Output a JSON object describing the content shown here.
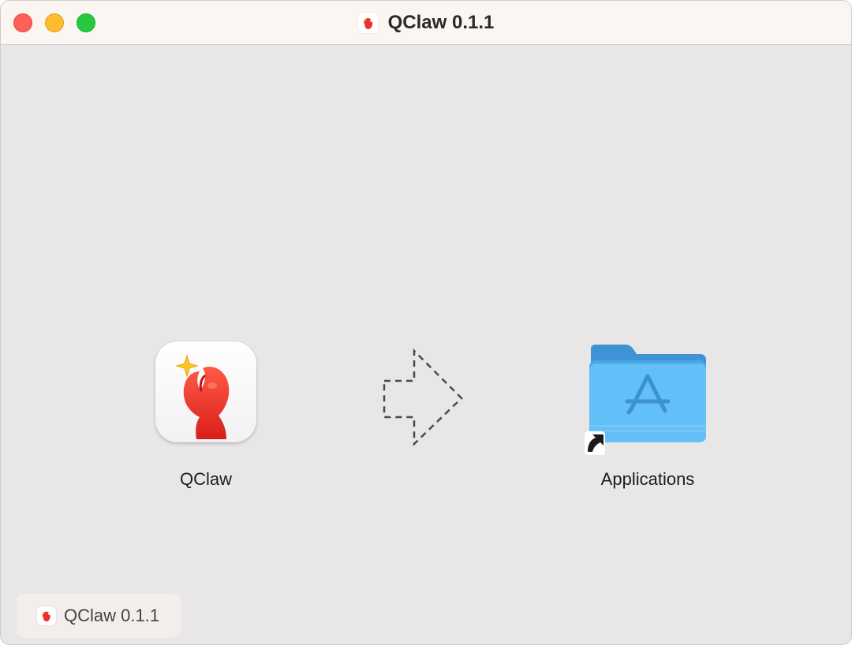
{
  "window": {
    "title": "QClaw 0.1.1"
  },
  "content": {
    "app_label": "QClaw",
    "folder_label": "Applications"
  },
  "statusbar": {
    "volume_name": "QClaw 0.1.1"
  },
  "colors": {
    "titlebar_bg": "#fbf6f2",
    "window_bg": "#e8e6e6",
    "folder_blue": "#5fbcf5",
    "claw_red": "#e8322b"
  },
  "icons": {
    "app": "qclaw-claw-icon",
    "arrow": "dashed-right-arrow",
    "folder": "applications-folder-icon",
    "alias": "alias-arrow-icon"
  }
}
